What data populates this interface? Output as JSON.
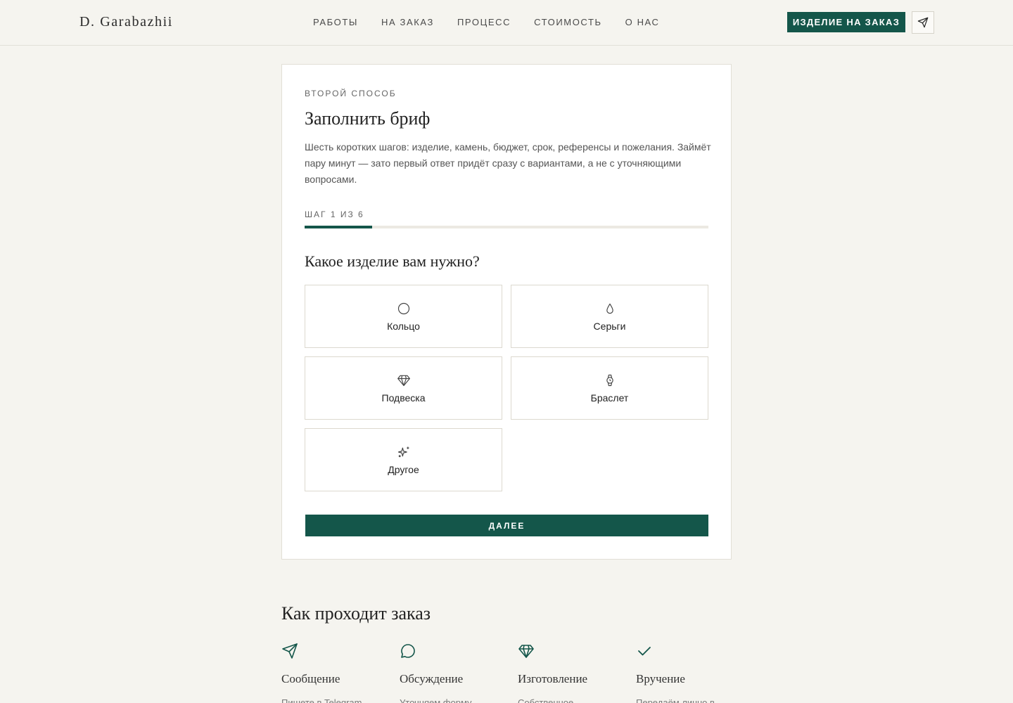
{
  "header": {
    "logo": "D. Garabazhii",
    "nav": [
      "РАБОТЫ",
      "НА ЗАКАЗ",
      "ПРОЦЕСС",
      "СТОИМОСТЬ",
      "О НАС"
    ],
    "order_button": "ИЗДЕЛИЕ НА ЗАКАЗ",
    "telegram_icon": "paper-plane-icon"
  },
  "brief": {
    "kicker": "ВТОРОЙ СПОСОБ",
    "title": "Заполнить бриф",
    "description": "Шесть коротких шагов: изделие, камень, бюджет, срок, референсы и пожелания. Займёт пару минут — зато первый ответ придёт сразу с вариантами, а не с уточняющими вопросами.",
    "step_label": "ШАГ 1 ИЗ 6",
    "progress": {
      "current": 1,
      "total": 6
    },
    "question": "Какое изделие вам нужно?",
    "options": [
      {
        "label": "Кольцо",
        "icon": "ring-icon"
      },
      {
        "label": "Серьги",
        "icon": "drop-icon"
      },
      {
        "label": "Подвеска",
        "icon": "gem-icon"
      },
      {
        "label": "Браслет",
        "icon": "watch-icon"
      },
      {
        "label": "Другое",
        "icon": "sparkles-icon"
      }
    ],
    "next_button": "ДАЛЕЕ"
  },
  "process": {
    "title": "Как проходит заказ",
    "steps": [
      {
        "name": "Сообщение",
        "icon": "send-icon",
        "desc": "Пишете в Telegram"
      },
      {
        "name": "Обсуждение",
        "icon": "chat-bubble-icon",
        "desc": "Уточняем форму"
      },
      {
        "name": "Изготовление",
        "icon": "diamond-icon",
        "desc": "Собственное"
      },
      {
        "name": "Вручение",
        "icon": "check-icon",
        "desc": "Передаём лично в"
      }
    ]
  },
  "colors": {
    "accent": "#14564a",
    "background": "#f5f4ef",
    "card": "#ffffff"
  }
}
